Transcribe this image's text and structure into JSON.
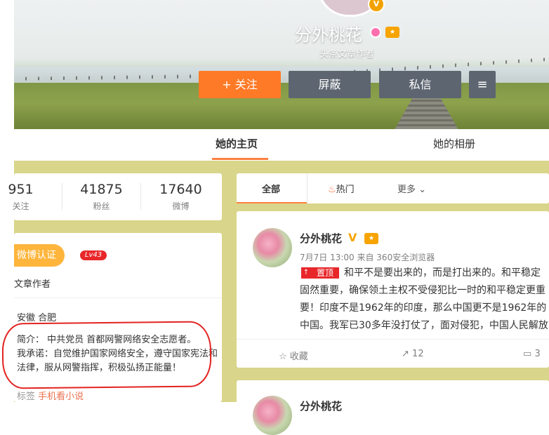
{
  "header": {
    "name": "分外桃花",
    "description": "头条文章作者",
    "buttons": {
      "follow": "+ 关注",
      "block": "屏蔽",
      "message": "私信",
      "menu": "≡"
    }
  },
  "tabs": {
    "home": "她的主页",
    "album": "她的相册"
  },
  "counts": [
    {
      "value": "951",
      "label": "关注"
    },
    {
      "value": "41875",
      "label": "粉丝"
    },
    {
      "value": "17640",
      "label": "微博"
    }
  ],
  "info": {
    "verify": "微博认证",
    "level": "Lv43",
    "role": "文章作者",
    "location": "安徽 合肥",
    "bio_line1": "简介： 中共党员 首都网警网络安全志愿者。",
    "bio_line2": "我承诺：自觉维护国家网络安全，遵守国家宪法和法律，服从网警指挥，积极弘扬正能量！",
    "tags_prefix": "标签",
    "tags_value": "手机看小说"
  },
  "feed_tabs": {
    "all": "全部",
    "hot": "热门",
    "more": "更多"
  },
  "post": {
    "author": "分外桃花",
    "v": "V",
    "meta": "7月7日 13:00 来自 360安全浏览器",
    "pin_label": "置顶",
    "text": "和平不是要出来的，而是打出来的。和平稳定固然重要，确保领土主权不受侵犯比一时的和平稳定更重要！印度不是1962年的印度，那么中国更不是1962年的中国。我军已30多年没打仗了，面对侵犯，中国人民解放军有必要在高原地区再一次抗拒",
    "actions": {
      "favorite": "收藏",
      "share_count": "12",
      "comment_count": "3"
    }
  },
  "post2": {
    "author": "分外桃花"
  },
  "colors": {
    "accent": "#ff8140",
    "follow_button": "#ff7a26",
    "dark_button": "#5d6570",
    "body_bg": "#d9d58a",
    "annotation_ring": "#e3231f"
  }
}
